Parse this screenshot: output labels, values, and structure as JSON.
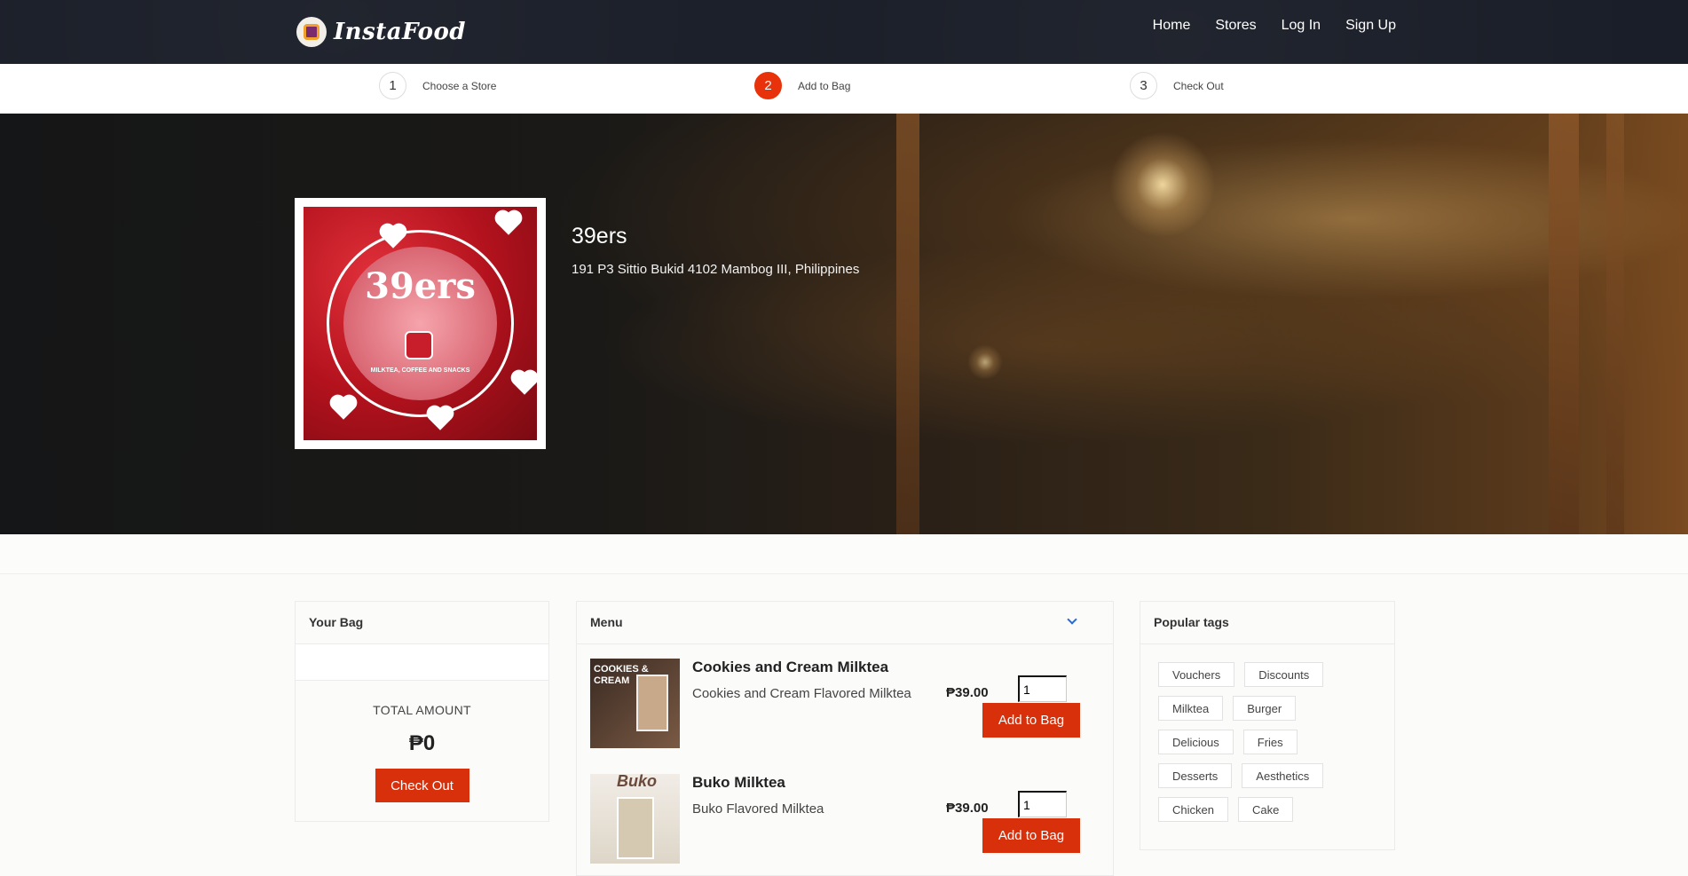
{
  "brand": {
    "name": "InstaFood"
  },
  "nav": {
    "home": "Home",
    "stores": "Stores",
    "login": "Log In",
    "signup": "Sign Up"
  },
  "steps": [
    {
      "num": "1",
      "label": "Choose a Store"
    },
    {
      "num": "2",
      "label": "Add to Bag"
    },
    {
      "num": "3",
      "label": "Check Out"
    }
  ],
  "store": {
    "name": "39ers",
    "address": "191 P3 Sittio Bukid 4102 Mambog III, Philippines",
    "logo_text": "39ers",
    "logo_sub": "MILKTEA, COFFEE AND SNACKS"
  },
  "bag": {
    "title": "Your Bag",
    "total_label": "TOTAL AMOUNT",
    "total_value": "₱0",
    "checkout": "Check Out"
  },
  "menu": {
    "title": "Menu",
    "items": [
      {
        "name": "Cookies and Cream Milktea",
        "desc": "Cookies and Cream Flavored Milktea",
        "price": "₱39.00",
        "qty": "1",
        "button": "Add to Bag",
        "img_text": "COOKIES & CREAM"
      },
      {
        "name": "Buko Milktea",
        "desc": "Buko Flavored Milktea",
        "price": "₱39.00",
        "qty": "1",
        "button": "Add to Bag",
        "img_text": "Buko"
      }
    ]
  },
  "popular_tags": {
    "title": "Popular tags",
    "tags": [
      "Vouchers",
      "Discounts",
      "Milktea",
      "Burger",
      "Delicious",
      "Fries",
      "Desserts",
      "Aesthetics",
      "Chicken",
      "Cake"
    ]
  },
  "colors": {
    "accent": "#d9300c",
    "navbar": "#1a1e28",
    "chevron": "#2a6ad6"
  }
}
